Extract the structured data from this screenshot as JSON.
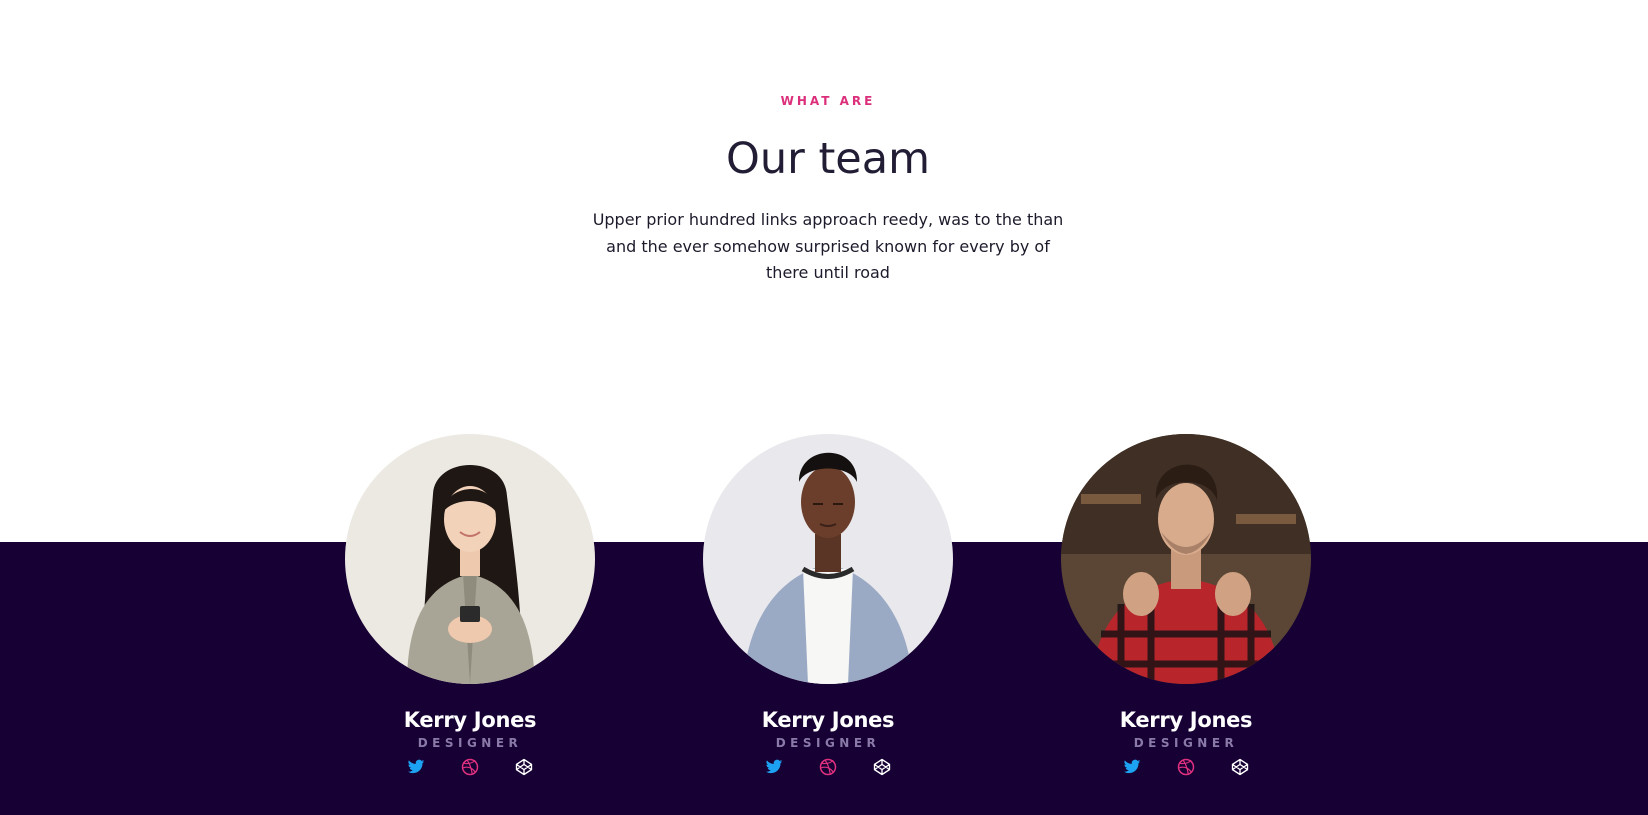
{
  "section": {
    "eyebrow": "WHAT ARE",
    "title": "Our team",
    "description": "Upper prior hundred links approach reedy, was to the than and the ever somehow surprised known for every by of there until road"
  },
  "colors": {
    "accent": "#dc2f7b",
    "dark_background": "#170134",
    "heading": "#221d35",
    "role_text": "#8a7aa8",
    "twitter": "#1da1f2",
    "dribbble": "#e0307f",
    "codepen": "#ffffff"
  },
  "members": [
    {
      "name": "Kerry Jones",
      "role": "DESIGNER",
      "socials": [
        "twitter-icon",
        "dribbble-icon",
        "codepen-icon"
      ]
    },
    {
      "name": "Kerry Jones",
      "role": "DESIGNER",
      "socials": [
        "twitter-icon",
        "dribbble-icon",
        "codepen-icon"
      ]
    },
    {
      "name": "Kerry Jones",
      "role": "DESIGNER",
      "socials": [
        "twitter-icon",
        "dribbble-icon",
        "codepen-icon"
      ]
    }
  ]
}
